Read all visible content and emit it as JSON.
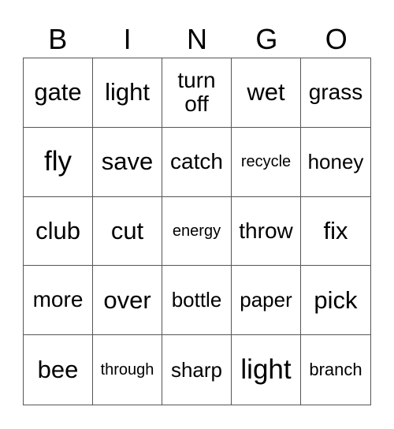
{
  "header": [
    "B",
    "I",
    "N",
    "G",
    "O"
  ],
  "cells": [
    [
      "gate",
      "light",
      "turn\noff",
      "wet",
      "grass"
    ],
    [
      "fly",
      "save",
      "catch",
      "recycle",
      "honey"
    ],
    [
      "club",
      "cut",
      "energy",
      "throw",
      "fix"
    ],
    [
      "more",
      "over",
      "bottle",
      "paper",
      "pick"
    ],
    [
      "bee",
      "through",
      "sharp",
      "light",
      "branch"
    ]
  ]
}
